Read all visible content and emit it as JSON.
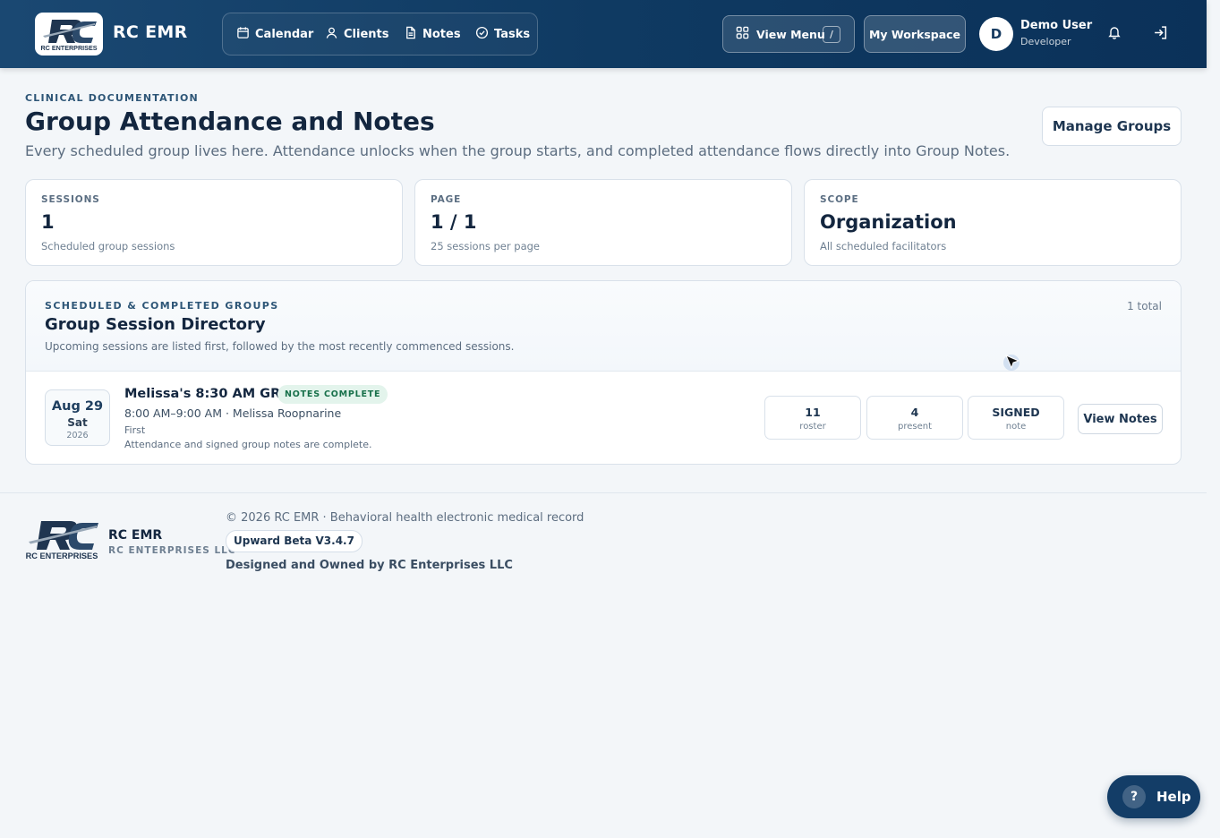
{
  "header": {
    "logo_text": "RC ENTERPRISES",
    "brand": "RC EMR",
    "nav": [
      {
        "label": "Calendar",
        "icon": "calendar-icon"
      },
      {
        "label": "Clients",
        "icon": "user-icon"
      },
      {
        "label": "Notes",
        "icon": "document-icon"
      },
      {
        "label": "Tasks",
        "icon": "check-circle-icon"
      }
    ],
    "view_menu_label": "View Menu",
    "view_menu_shortcut": "/",
    "workspace_label": "My Workspace",
    "user": {
      "initial": "D",
      "name": "Demo User",
      "role": "Developer"
    },
    "icons": {
      "notifications": "bell-icon",
      "logout": "sign-out-icon"
    }
  },
  "page": {
    "eyebrow": "CLINICAL DOCUMENTATION",
    "title": "Group Attendance and Notes",
    "subtitle": "Every scheduled group lives here. Attendance unlocks when the group starts, and completed attendance flows directly into Group Notes.",
    "manage_button": "Manage Groups"
  },
  "stats": [
    {
      "label": "SESSIONS",
      "value": "1",
      "note": "Scheduled group sessions"
    },
    {
      "label": "PAGE",
      "value": "1 / 1",
      "note": "25 sessions per page"
    },
    {
      "label": "SCOPE",
      "value": "Organization",
      "note": "All scheduled facilitators"
    }
  ],
  "directory": {
    "eyebrow": "SCHEDULED & COMPLETED GROUPS",
    "title": "Group Session Directory",
    "subtitle": "Upcoming sessions are listed first, followed by the most recently commenced sessions.",
    "total": "1 total",
    "sessions": [
      {
        "date_md": "Aug 29",
        "date_dow": "Sat",
        "date_year": "2026",
        "title": "Melissa's 8:30 AM GRP",
        "badge": "NOTES COMPLETE",
        "time": "8:00 AM–9:00 AM · Melissa Roopnarine",
        "type": "First",
        "status": "Attendance and signed group notes are complete.",
        "metrics": [
          {
            "value": "11",
            "label": "roster"
          },
          {
            "value": "4",
            "label": "present"
          },
          {
            "value": "SIGNED",
            "label": "note"
          }
        ],
        "action": "View Notes"
      }
    ]
  },
  "footer": {
    "logo_text": "RC ENTERPRISES",
    "brand": "RC EMR",
    "company": "RC ENTERPRISES LLC",
    "copyright": "© 2026 RC EMR · Behavioral health electronic medical record",
    "version": "Upward Beta V3.4.7",
    "owner": "Designed and Owned by RC Enterprises LLC"
  },
  "help": {
    "label": "Help",
    "glyph": "?"
  },
  "colors": {
    "header_bg": "#0f3a62",
    "accent": "#133d67",
    "badge_bg": "#e3f4ec",
    "badge_text": "#17704a"
  }
}
